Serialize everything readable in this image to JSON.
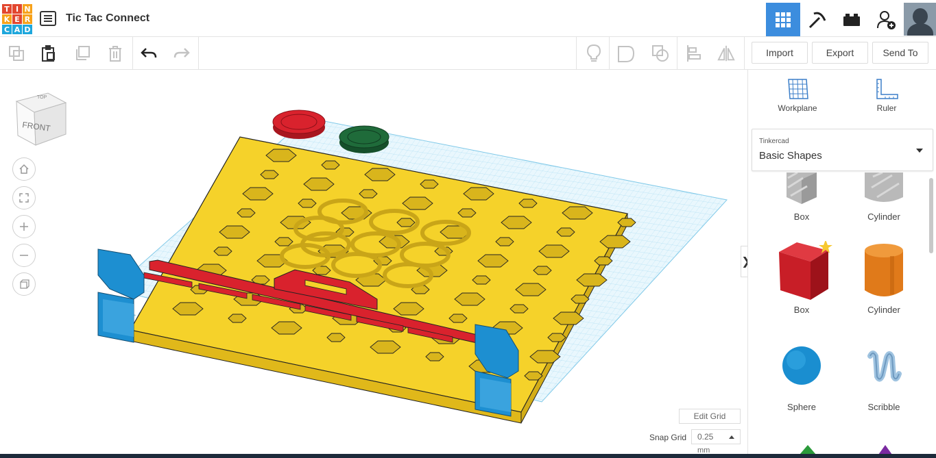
{
  "app": {
    "logo_letters": [
      "T",
      "I",
      "N",
      "K",
      "E",
      "R",
      "C",
      "A",
      "D"
    ],
    "logo_colors": [
      "#e2472f",
      "#e2472f",
      "#f7a21b",
      "#f7a21b",
      "#e2472f",
      "#f7a21b",
      "#1ea7dc",
      "#1ea7dc",
      "#1ea7dc"
    ],
    "title": "Tic Tac Connect"
  },
  "header": {
    "modes": [
      {
        "name": "3d-view-icon",
        "active": true
      },
      {
        "name": "pickaxe-icon",
        "active": false
      },
      {
        "name": "bricks-icon",
        "active": false
      },
      {
        "name": "add-user-icon",
        "active": false
      }
    ]
  },
  "toolbar": {
    "left_icons": [
      "copy-icon",
      "paste-icon",
      "duplicate-icon",
      "delete-icon",
      "undo-icon",
      "redo-icon"
    ],
    "right_icons": [
      "lightbulb-icon",
      "group-icon",
      "ungroup-icon",
      "align-icon",
      "mirror-icon"
    ],
    "import_label": "Import",
    "export_label": "Export",
    "send_to_label": "Send To"
  },
  "canvas": {
    "viewcube_front": "FRONT",
    "viewcube_top": "TOP",
    "nav_buttons": [
      "home-view-icon",
      "fit-view-icon",
      "zoom-in-icon",
      "zoom-out-icon",
      "orthographic-icon"
    ],
    "workplane_watermark": "Workplane",
    "edit_grid_label": "Edit Grid",
    "snap_grid_label": "Snap Grid",
    "snap_value": "0.25",
    "snap_unit": "mm",
    "collapse_glyph": "❯"
  },
  "panel": {
    "workplane_label": "Workplane",
    "ruler_label": "Ruler",
    "library_category": "Tinkercad",
    "library_name": "Basic Shapes",
    "shapes": [
      {
        "label": "Box",
        "color": "#b9b9b9"
      },
      {
        "label": "Cylinder",
        "color": "#b9b9b9"
      },
      {
        "label": "Box",
        "color": "#d0202a"
      },
      {
        "label": "Cylinder",
        "color": "#e07a1a"
      },
      {
        "label": "Sphere",
        "color": "#1a8ed0"
      },
      {
        "label": "Scribble",
        "color": "#9fc3e0"
      }
    ]
  },
  "colors": {
    "accent": "#3c8dde",
    "board": "#f5d22a",
    "holder": "#1d8fd1",
    "slider": "#d9222d",
    "token_red": "#d9222d",
    "token_green": "#1f6b3a",
    "grid": "#7ec8e8"
  }
}
